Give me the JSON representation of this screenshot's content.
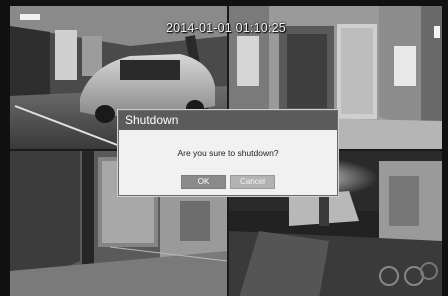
{
  "overlay": {
    "timestamp": "2014-01-01 01:10:25"
  },
  "cameras": [
    {
      "scene": "parking-garage-with-car"
    },
    {
      "scene": "corridor-with-doors"
    },
    {
      "scene": "lobby-entrance"
    },
    {
      "scene": "night-parking-area"
    }
  ],
  "dialog": {
    "title": "Shutdown",
    "message": "Are you sure to shutdown?",
    "ok_label": "OK",
    "cancel_label": "Cancel"
  }
}
